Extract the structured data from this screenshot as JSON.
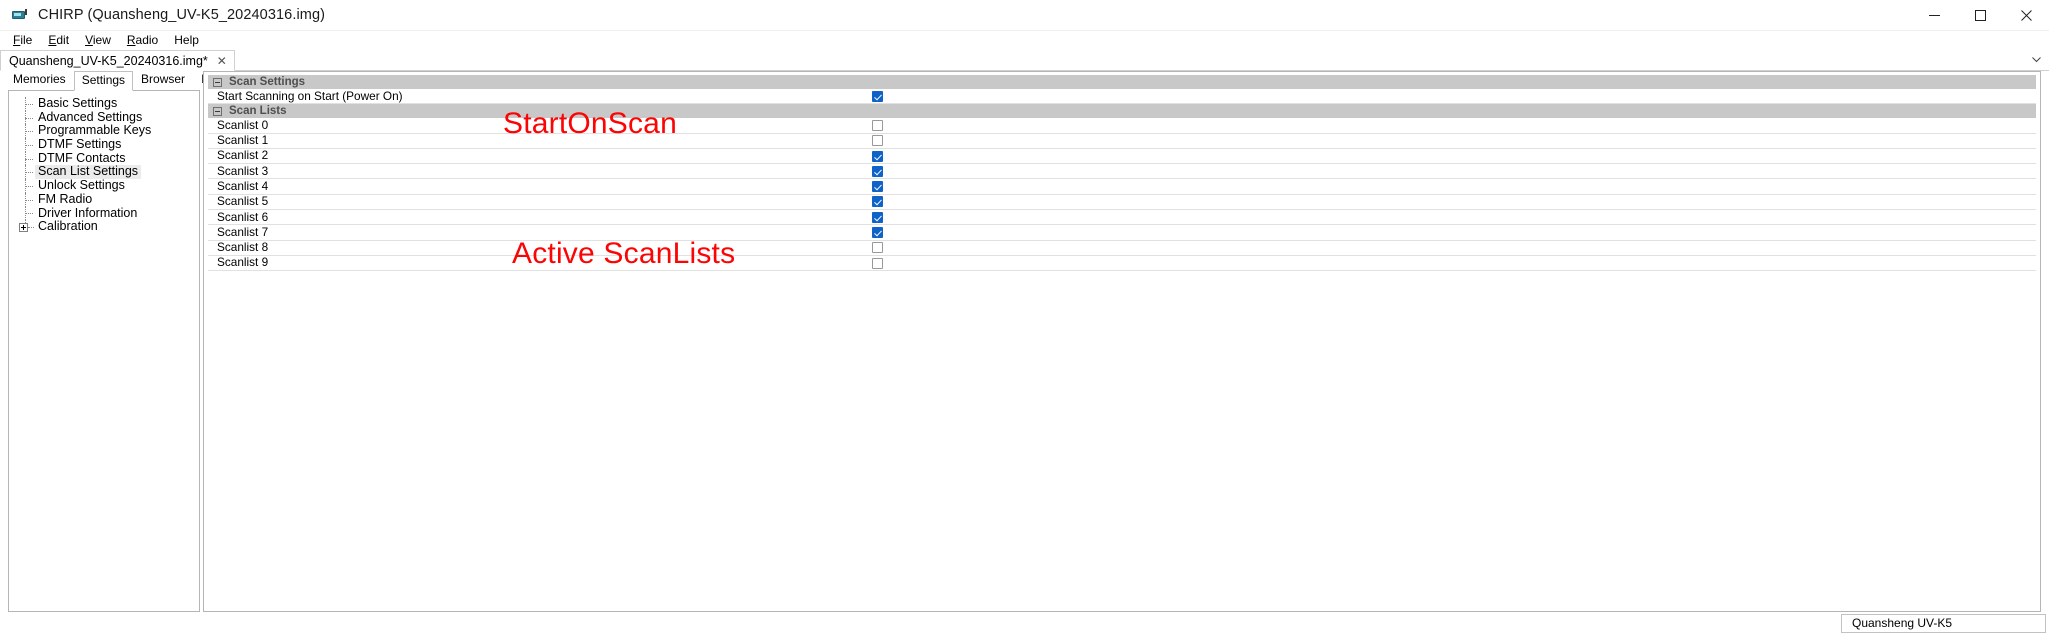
{
  "window": {
    "title": "CHIRP (Quansheng_UV-K5_20240316.img)",
    "icon": "radio-icon",
    "controls": {
      "minimize": "minimize-icon",
      "maximize": "maximize-icon",
      "close": "close-icon"
    }
  },
  "menubar": {
    "items": [
      {
        "label": "File",
        "accel": "F"
      },
      {
        "label": "Edit",
        "accel": "E"
      },
      {
        "label": "View",
        "accel": "V"
      },
      {
        "label": "Radio",
        "accel": "R"
      },
      {
        "label": "Help",
        "accel": "H"
      }
    ]
  },
  "filetabs": {
    "tabs": [
      {
        "label": "Quansheng_UV-K5_20240316.img*",
        "close": "✕",
        "active": true
      }
    ],
    "overflow_chevron": "chevron-down-icon"
  },
  "subtabs": {
    "items": [
      {
        "label": "Memories",
        "active": false
      },
      {
        "label": "Settings",
        "active": true
      },
      {
        "label": "Browser",
        "active": false
      },
      {
        "label": "Info",
        "active": false
      }
    ]
  },
  "sidebar": {
    "items": [
      {
        "label": "Basic Settings",
        "selected": false,
        "expandable": false
      },
      {
        "label": "Advanced Settings",
        "selected": false,
        "expandable": false
      },
      {
        "label": "Programmable Keys",
        "selected": false,
        "expandable": false
      },
      {
        "label": "DTMF Settings",
        "selected": false,
        "expandable": false
      },
      {
        "label": "DTMF Contacts",
        "selected": false,
        "expandable": false
      },
      {
        "label": "Scan List Settings",
        "selected": true,
        "expandable": false
      },
      {
        "label": "Unlock Settings",
        "selected": false,
        "expandable": false
      },
      {
        "label": "FM Radio",
        "selected": false,
        "expandable": false
      },
      {
        "label": "Driver Information",
        "selected": false,
        "expandable": false
      },
      {
        "label": "Calibration",
        "selected": false,
        "expandable": true
      }
    ]
  },
  "main": {
    "groups": [
      {
        "title": "Scan Settings",
        "collapse_icon": "minus-box-icon",
        "rows": [
          {
            "label": "Start Scanning on Start (Power On)",
            "checked": true
          }
        ]
      },
      {
        "title": "Scan Lists",
        "collapse_icon": "minus-box-icon",
        "rows": [
          {
            "label": "Scanlist 0",
            "checked": false
          },
          {
            "label": "Scanlist 1",
            "checked": false
          },
          {
            "label": "Scanlist 2",
            "checked": true
          },
          {
            "label": "Scanlist 3",
            "checked": true
          },
          {
            "label": "Scanlist 4",
            "checked": true
          },
          {
            "label": "Scanlist 5",
            "checked": true
          },
          {
            "label": "Scanlist 6",
            "checked": true
          },
          {
            "label": "Scanlist 7",
            "checked": true
          },
          {
            "label": "Scanlist 8",
            "checked": false
          },
          {
            "label": "Scanlist 9",
            "checked": false
          }
        ]
      }
    ]
  },
  "annotations": [
    {
      "text": "StartOnScan",
      "color": "#fc0404"
    },
    {
      "text": "Active ScanLists",
      "color": "#fc0404"
    }
  ],
  "statusbar": {
    "radio_model": "Quansheng UV-K5"
  },
  "colors": {
    "checkbox_checked": "#0f62c8",
    "group_header_bg": "#c8c8c8",
    "annotation_red": "#fc0404"
  }
}
